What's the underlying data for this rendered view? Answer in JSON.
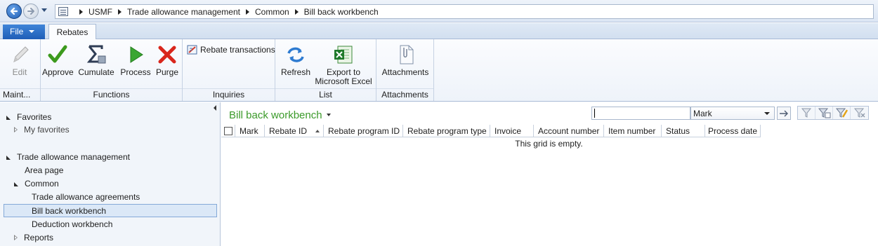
{
  "address_bar": {
    "breadcrumbs": [
      "USMF",
      "Trade allowance management",
      "Common",
      "Bill back workbench"
    ]
  },
  "tabs": {
    "file_label": "File",
    "active_tab": "Rebates"
  },
  "ribbon": {
    "groups": {
      "maintain": {
        "label": "Maint...",
        "edit_label": "Edit"
      },
      "functions": {
        "label": "Functions",
        "approve": "Approve",
        "cumulate": "Cumulate",
        "process": "Process",
        "purge": "Purge"
      },
      "inquiries": {
        "label": "Inquiries",
        "rebate_transactions": "Rebate transactions"
      },
      "list": {
        "label": "List",
        "refresh": "Refresh",
        "export_line1": "Export to",
        "export_line2": "Microsoft Excel"
      },
      "attachments": {
        "label": "Attachments",
        "attachments_button": "Attachments"
      }
    }
  },
  "navpane": {
    "favorites": "Favorites",
    "my_favorites": "My favorites",
    "module": "Trade allowance management",
    "area_page": "Area page",
    "common": "Common",
    "trade_allowance_agreements": "Trade allowance agreements",
    "bill_back_workbench": "Bill back workbench",
    "deduction_workbench": "Deduction workbench",
    "reports": "Reports"
  },
  "content": {
    "title": "Bill back workbench",
    "filter": {
      "value": "",
      "field": "Mark"
    },
    "grid": {
      "columns": [
        "Mark",
        "Rebate ID",
        "Rebate program ID",
        "Rebate program type",
        "Invoice",
        "Account number",
        "Item number",
        "Status",
        "Process date"
      ],
      "empty_text": "This grid is empty."
    }
  },
  "colors": {
    "title_green": "#3b9a2a",
    "file_tab_blue": "#1f5eb7",
    "selection": "#dbe8f7"
  }
}
